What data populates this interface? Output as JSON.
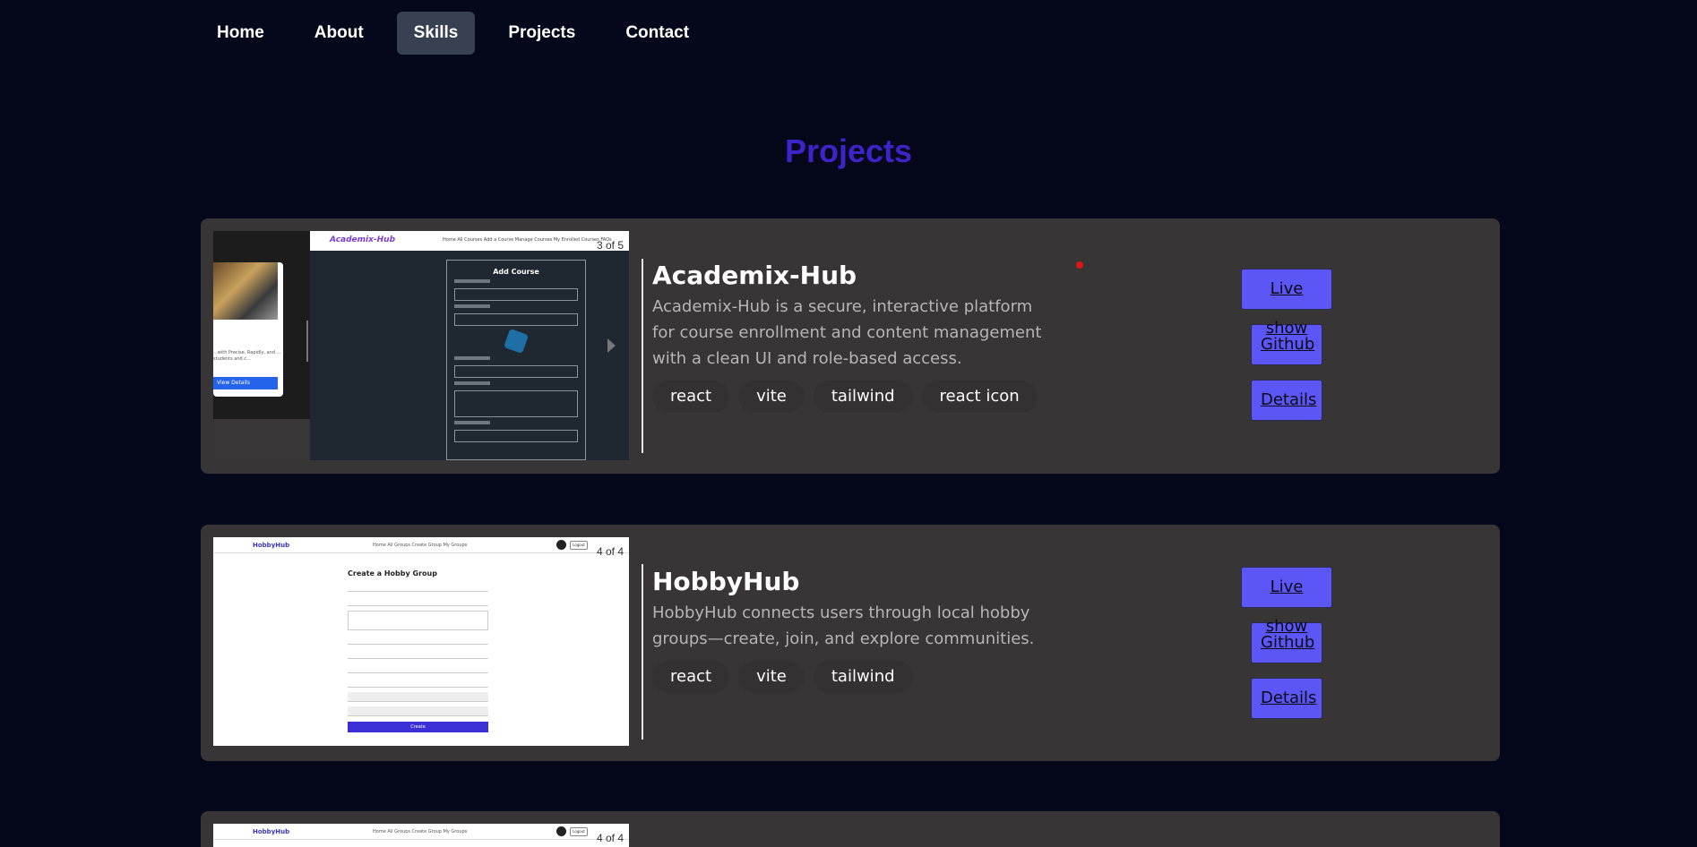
{
  "nav": {
    "items": [
      {
        "label": "Home",
        "active": false
      },
      {
        "label": "About",
        "active": false
      },
      {
        "label": "Skills",
        "active": true
      },
      {
        "label": "Projects",
        "active": false
      },
      {
        "label": "Contact",
        "active": false
      }
    ]
  },
  "section": {
    "title": "Projects",
    "title_color": "#3b24c8"
  },
  "colors": {
    "background": "#04081a",
    "card": "#373535",
    "button": "#5b56f5",
    "active_nav": "#374151"
  },
  "projects": [
    {
      "name": "Academix-Hub",
      "description": "Academix-Hub is a secure, interactive platform for course enrollment and content management with a clean UI and role-based access.",
      "tags": [
        "react",
        "vite",
        "tailwind",
        "react icon"
      ],
      "counter": "3 of 5",
      "buttons": {
        "live": "Live show",
        "github": "Github",
        "details": "Details"
      },
      "preview": {
        "brand": "Academix-Hub",
        "nav": "Home   All Courses   Add a Course   Manage Courses   My Enrolled Courses   FAQs",
        "form_title": "Add Course",
        "left_text": "...with Precise, Rapidly, and ... students and c...",
        "left_button": "View Details"
      }
    },
    {
      "name": "HobbyHub",
      "description": "HobbyHub connects users through local hobby groups—create, join, and explore communities.",
      "tags": [
        "react",
        "vite",
        "tailwind"
      ],
      "counter": "4 of 4",
      "buttons": {
        "live": "Live show",
        "github": "Github",
        "details": "Details"
      },
      "preview": {
        "brand": "HobbyHub",
        "nav": "Home     All Groups     Create Group     My Groups",
        "logout": "Logout",
        "form_title": "Create a Hobby Group",
        "submit": "Create"
      }
    },
    {
      "counter": "4 of 4",
      "preview": {
        "brand": "HobbyHub",
        "nav": "Home     All Groups     Create Group     My Groups",
        "logout": "Logout"
      }
    }
  ]
}
